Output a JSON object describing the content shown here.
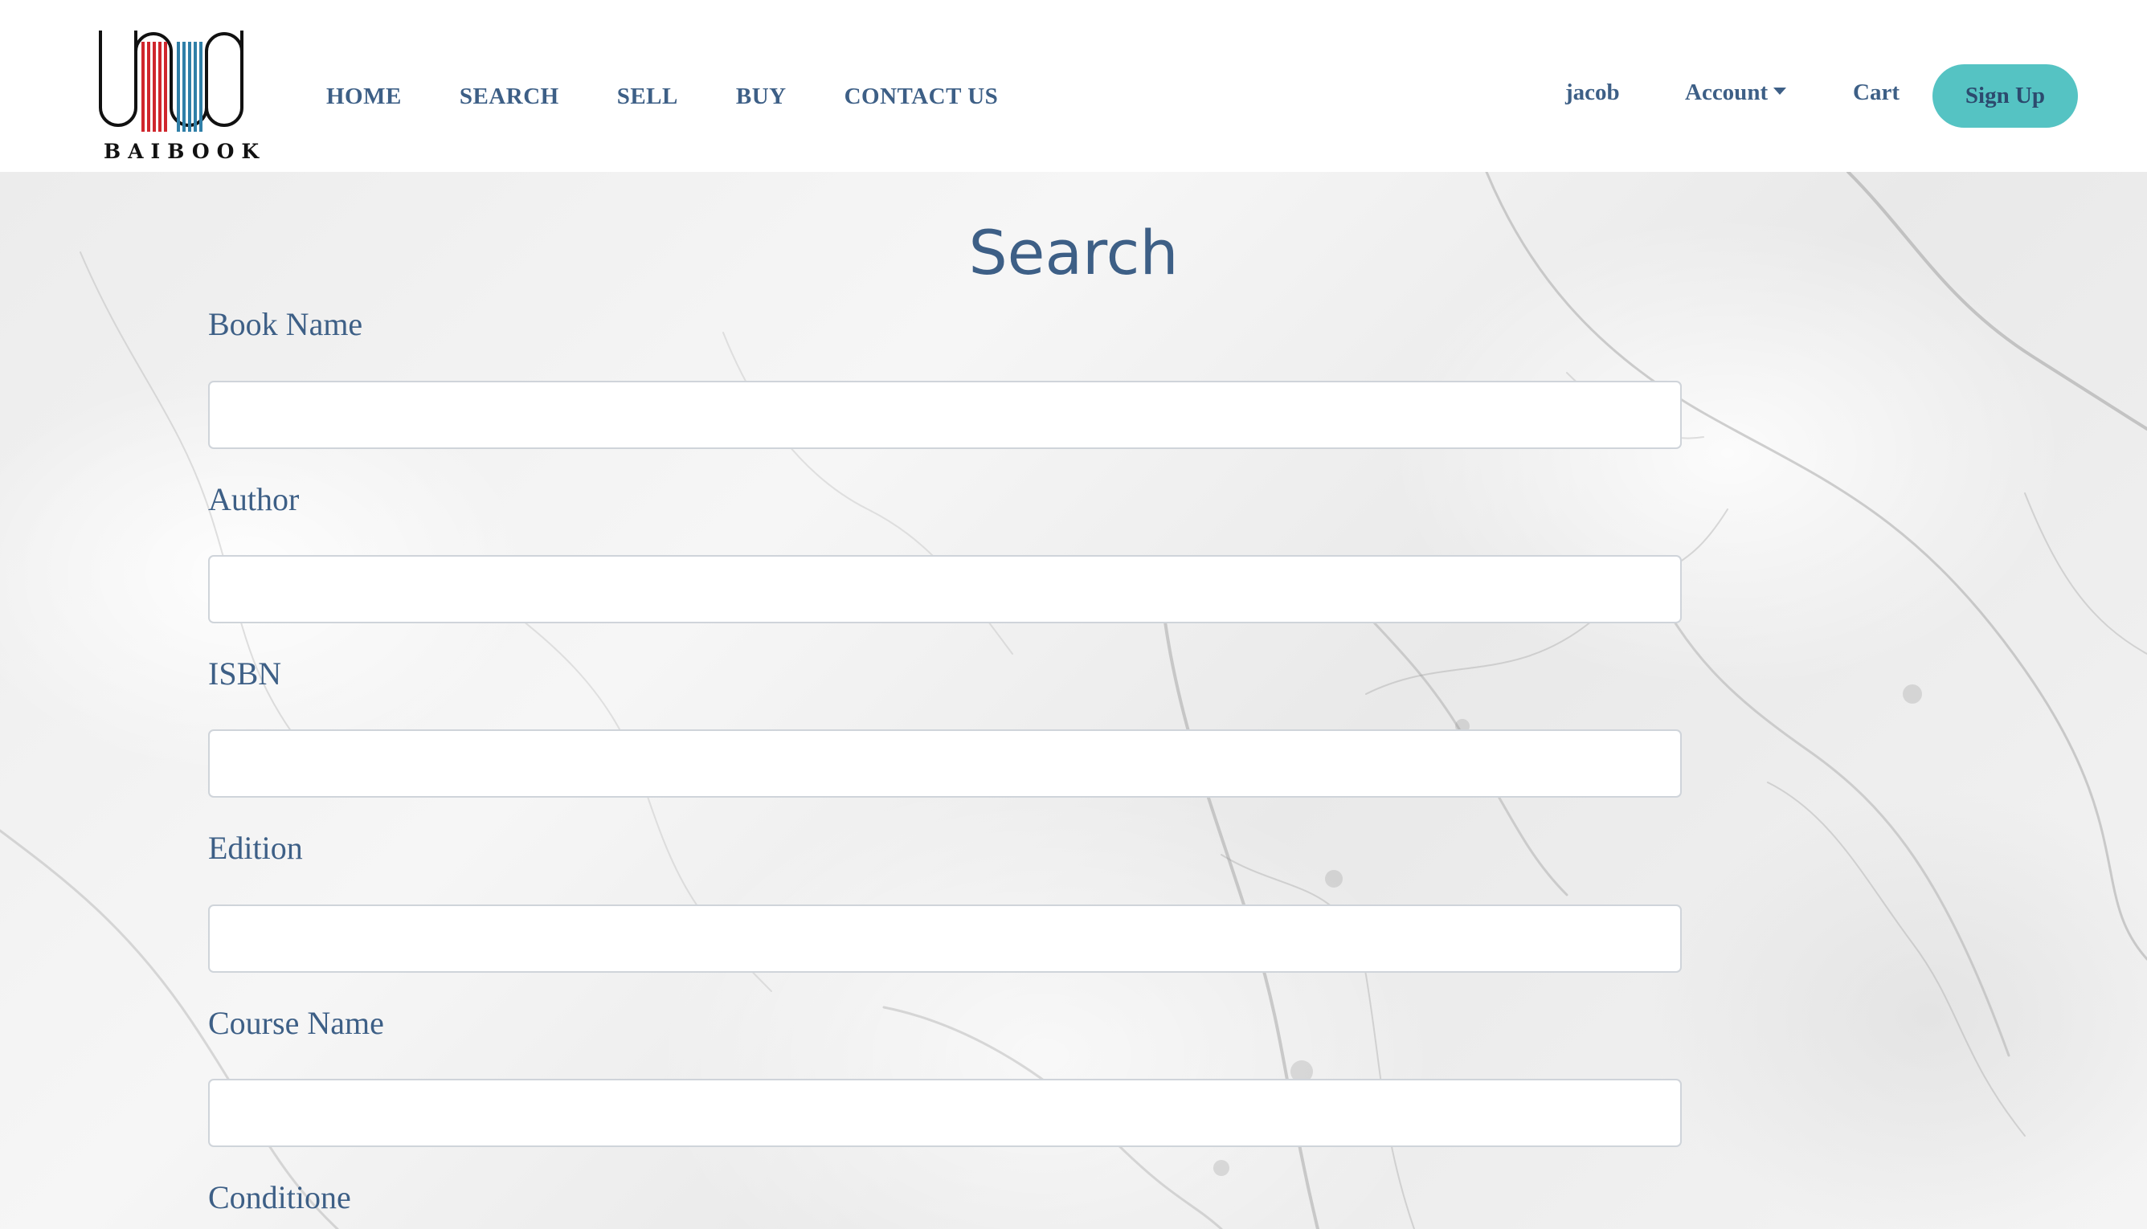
{
  "header": {
    "logo_text": "BAIBOOK",
    "nav": [
      "HOME",
      "SEARCH",
      "SELL",
      "BUY",
      "CONTACT US"
    ],
    "user": "jacob",
    "account_label": "Account",
    "cart_label": "Cart",
    "signup_label": "Sign Up"
  },
  "page": {
    "title": "Search"
  },
  "form": {
    "fields": [
      {
        "label": "Book Name",
        "value": "",
        "placeholder": ""
      },
      {
        "label": "Author",
        "value": "",
        "placeholder": ""
      },
      {
        "label": "ISBN",
        "value": "",
        "placeholder": ""
      },
      {
        "label": "Edition",
        "value": "",
        "placeholder": ""
      },
      {
        "label": "Course Name",
        "value": "",
        "placeholder": ""
      },
      {
        "label": "Conditione"
      }
    ]
  },
  "icons": {
    "logo": "book-arches-logo",
    "account_caret": "caret-down-icon"
  },
  "colors": {
    "brand_text": "#3d5f86",
    "signup_bg": "#55c3c3",
    "logo_red": "#d0262d",
    "logo_blue": "#2f7fa8"
  }
}
